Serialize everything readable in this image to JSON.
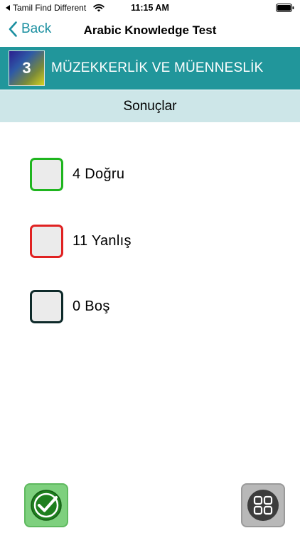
{
  "status_bar": {
    "carrier": "Tamil Find Different",
    "time": "11:15 AM"
  },
  "nav": {
    "back_label": "Back",
    "title": "Arabic Knowledge Test"
  },
  "topic": {
    "number": "3",
    "title": "MÜZEKKERLİK VE MÜENNESLİK"
  },
  "results": {
    "heading": "Sonuçlar",
    "items": [
      {
        "label": "4 Doğru",
        "color": "#1fb51f"
      },
      {
        "label": "11 Yanlış",
        "color": "#e02222"
      },
      {
        "label": "0 Boş",
        "color": "#0e2a2a"
      }
    ]
  },
  "colors": {
    "accent": "#21969b",
    "results_bg": "#cde6e8",
    "back_link": "#1a8fa0"
  },
  "bottom": {
    "left_icon": "check-circle-icon",
    "right_icon": "grid-menu-icon"
  }
}
